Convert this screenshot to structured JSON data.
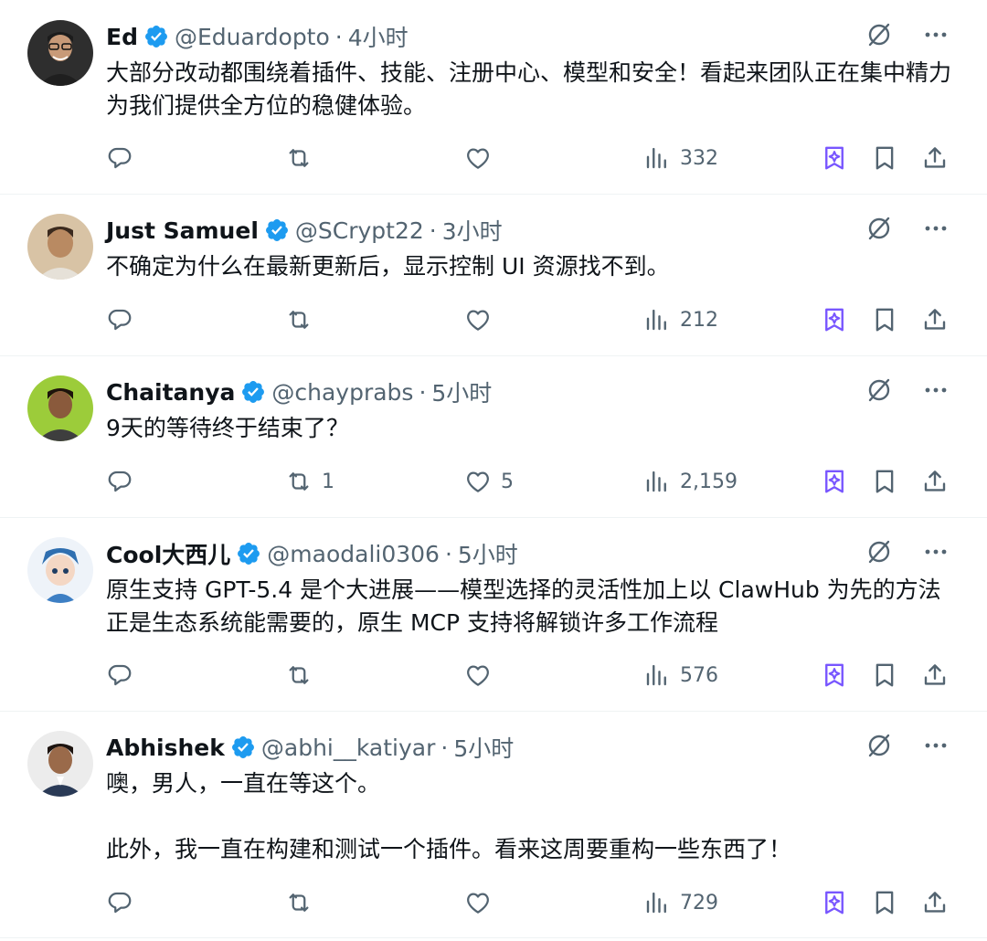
{
  "tweets": [
    {
      "name": "Ed",
      "handle": "@Eduardopto",
      "sep": "·",
      "time": "4小时",
      "text": "大部分改动都围绕着插件、技能、注册中心、模型和安全！看起来团队正在集中精力为我们提供全方位的稳健体验。",
      "replies": "",
      "reposts": "",
      "likes": "",
      "views": "332",
      "avatar_color": "#3a3a3a"
    },
    {
      "name": "Just Samuel",
      "handle": "@SCrypt22",
      "sep": "·",
      "time": "3小时",
      "text": "不确定为什么在最新更新后，显示控制 UI 资源找不到。",
      "replies": "",
      "reposts": "",
      "likes": "",
      "views": "212",
      "avatar_color": "#c9a27a"
    },
    {
      "name": "Chaitanya",
      "handle": "@chayprabs",
      "sep": "·",
      "time": "5小时",
      "text": "9天的等待终于结束了？",
      "replies": "",
      "reposts": "1",
      "likes": "5",
      "views": "2,159",
      "avatar_color": "#9ccc3a"
    },
    {
      "name": "Cool大西儿",
      "handle": "@maodali0306",
      "sep": "·",
      "time": "5小时",
      "text": "原生支持 GPT-5.4 是个大进展——模型选择的灵活性加上以 ClawHub 为先的方法正是生态系统能需要的，原生 MCP 支持将解锁许多工作流程",
      "replies": "",
      "reposts": "",
      "likes": "",
      "views": "576",
      "avatar_color": "#dfe8f3"
    },
    {
      "name": "Abhishek",
      "handle": "@abhi__katiyar",
      "sep": "·",
      "time": "5小时",
      "text": "噢，男人，一直在等这个。\n\n此外，我一直在构建和测试一个插件。看来这周要重构一些东西了！",
      "replies": "",
      "reposts": "",
      "likes": "",
      "views": "729",
      "avatar_color": "#e9e9e9"
    }
  ],
  "colors": {
    "verified": "#1d9bf0",
    "grok": "#7856ff",
    "icon_gray": "#536471"
  },
  "icons": [
    "verified-badge-icon",
    "grok-slash-icon",
    "more-icon",
    "reply-icon",
    "repost-icon",
    "like-icon",
    "views-icon",
    "grok-icon",
    "bookmark-icon",
    "share-icon"
  ]
}
